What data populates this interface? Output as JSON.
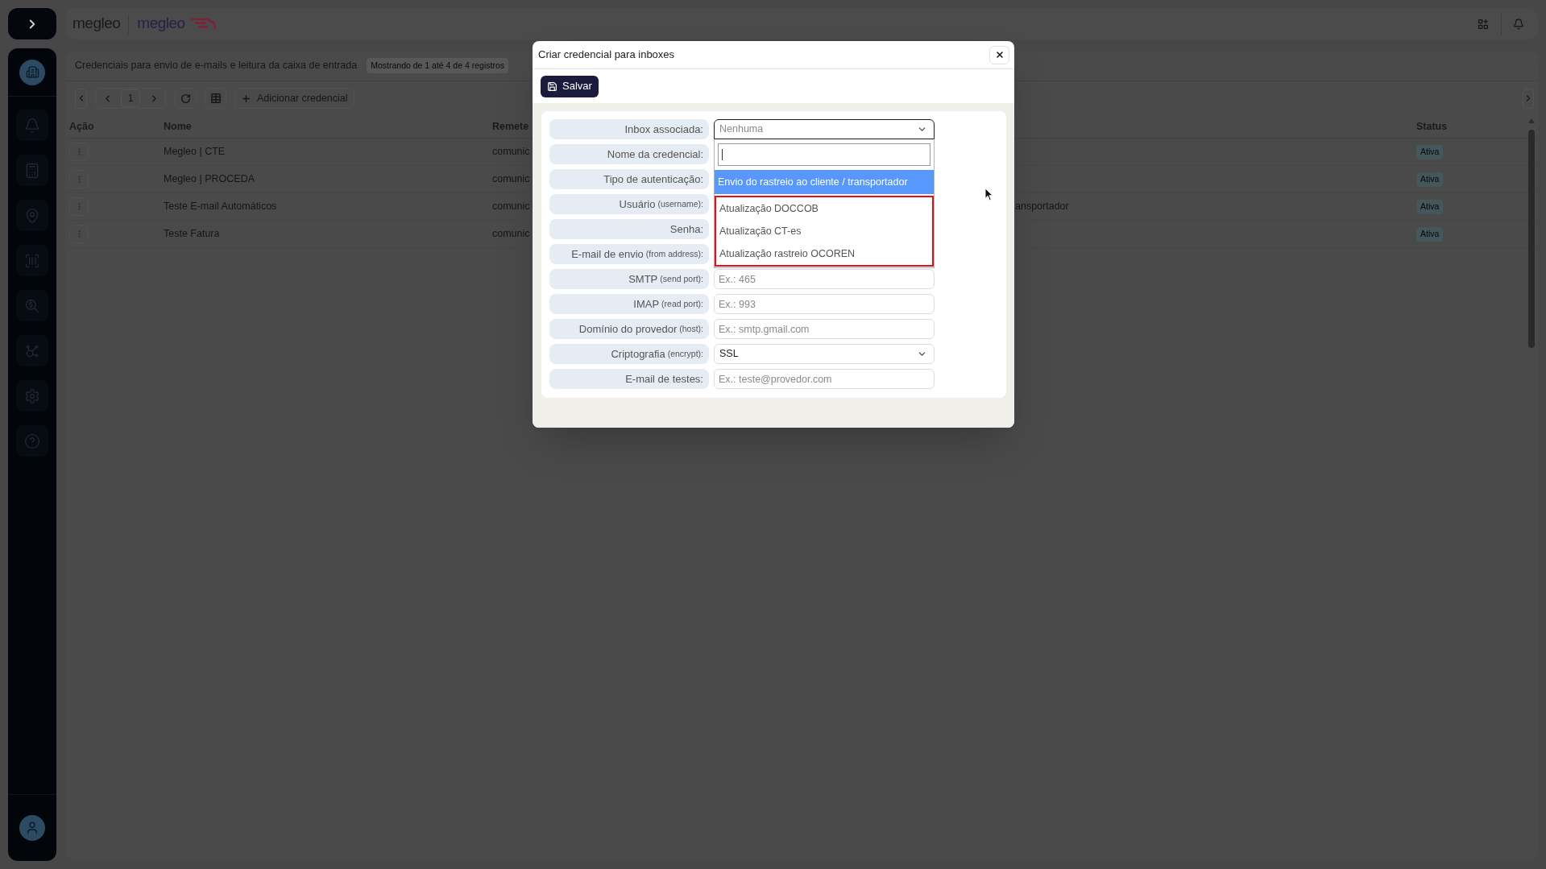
{
  "header": {
    "logo_texts": [
      "megleo",
      "megleo"
    ]
  },
  "page": {
    "title": "Credenciais para envio de e-mails e leitura da caixa de entrada",
    "record_count": "Mostrando de 1 até 4 de 4 registros",
    "toolbar": {
      "page": "1",
      "add_button": "Adicionar credencial"
    },
    "table": {
      "columns": [
        "Ação",
        "Nome",
        "Remete",
        "Status"
      ],
      "rows": [
        {
          "name": "Megleo | CTE",
          "sender": "comunic",
          "status": "Ativa"
        },
        {
          "name": "Megleo | PROCEDA",
          "sender": "comunic",
          "status": "Ativa"
        },
        {
          "name": "Teste E-mail Automáticos",
          "sender": "comunic",
          "column_4": "ansportador",
          "status": "Ativa"
        },
        {
          "name": "Teste Fatura",
          "sender": "comunic",
          "status": "Ativa"
        }
      ]
    }
  },
  "modal": {
    "title": "Criar credencial para inboxes",
    "save_button": "Salvar",
    "fields": [
      {
        "label": "Inbox associada:",
        "field": {
          "kind": "select",
          "placeholder": "Nenhuma",
          "open": true,
          "options": [
            {
              "label": "Envio do rastreio ao cliente / transportador",
              "selected": true,
              "framed": false
            },
            {
              "label": "Atualização DOCCOB",
              "selected": false,
              "framed": true
            },
            {
              "label": "Atualização CT-es",
              "selected": false,
              "framed": true
            },
            {
              "label": "Atualização rastreio OCOREN",
              "selected": false,
              "framed": true
            }
          ]
        }
      },
      {
        "label": "Nome da credencial:"
      },
      {
        "label": "Tipo de autenticação:"
      },
      {
        "label": "Usuário",
        "note": "(username):"
      },
      {
        "label": "Senha:"
      },
      {
        "label": "E-mail de envio",
        "note": "(from address):"
      },
      {
        "label": "SMTP",
        "note": "(send port):",
        "field": {
          "kind": "text",
          "placeholder": "Ex.: 465"
        }
      },
      {
        "label": "IMAP",
        "note": "(read port):",
        "field": {
          "kind": "text",
          "placeholder": "Ex.: 993"
        }
      },
      {
        "label": "Domínio do provedor",
        "note": "(host):",
        "field": {
          "kind": "text",
          "placeholder": "Ex.: smtp.gmail.com"
        }
      },
      {
        "label": "Criptografia",
        "note": "(encrypt):",
        "field": {
          "kind": "select",
          "value": "SSL",
          "open": false
        }
      },
      {
        "label": "E-mail de testes:",
        "field": {
          "kind": "text",
          "placeholder": "Ex.: teste@provedor.com"
        }
      }
    ]
  }
}
